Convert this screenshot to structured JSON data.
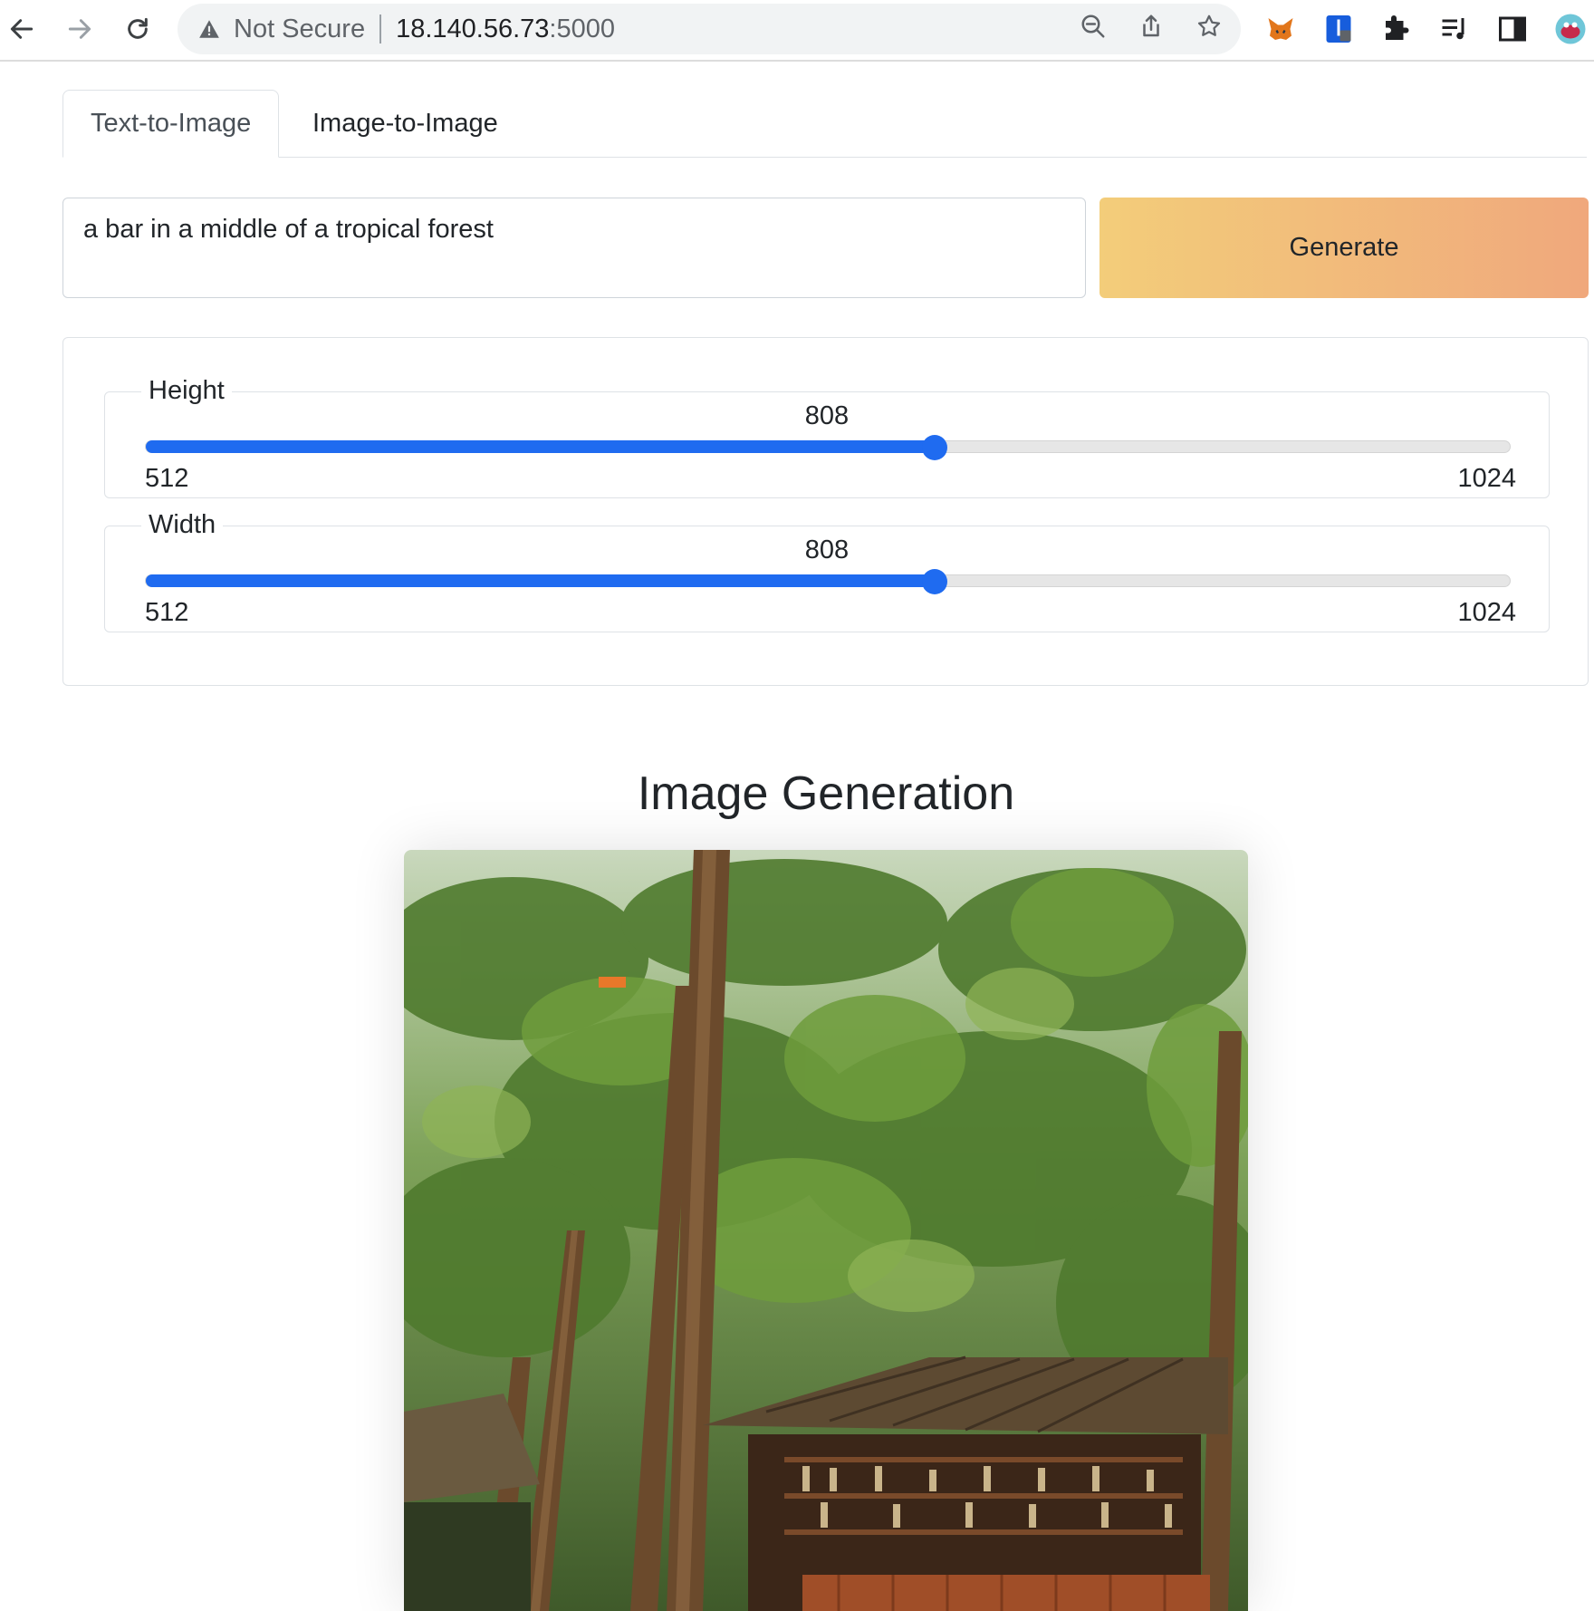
{
  "browser": {
    "security_label": "Not Secure",
    "url_host": "18.140.56.73",
    "url_port": ":5000"
  },
  "tabs": [
    {
      "label": "Text-to-Image",
      "active": true
    },
    {
      "label": "Image-to-Image",
      "active": false
    }
  ],
  "prompt": {
    "value": "a bar in a middle of a tropical forest"
  },
  "generate_label": "Generate",
  "sliders": {
    "height": {
      "label": "Height",
      "value": 808,
      "min": 512,
      "max": 1024
    },
    "width": {
      "label": "Width",
      "value": 808,
      "min": 512,
      "max": 1024
    }
  },
  "heading": "Image Generation",
  "colors": {
    "accent": "#1f6bf0",
    "generate_start": "#f3cd7a",
    "generate_end": "#f0a87c"
  },
  "icons": [
    "back-arrow-icon",
    "forward-arrow-icon",
    "reload-icon",
    "warning-icon",
    "zoom-out-icon",
    "share-icon",
    "bookmark-star-icon",
    "metamask-fox-icon",
    "bitwarden-icon",
    "extensions-puzzle-icon",
    "reading-list-icon",
    "side-panel-icon",
    "profile-avatar-icon"
  ]
}
